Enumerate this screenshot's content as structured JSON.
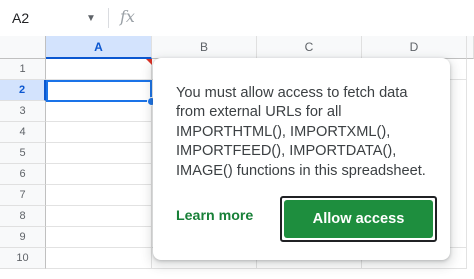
{
  "formula_bar": {
    "namebox_value": "A2",
    "caret": "▼",
    "fx_label": "fx"
  },
  "grid": {
    "columns": [
      "A",
      "B",
      "C",
      "D"
    ],
    "rows": [
      "1",
      "2",
      "3",
      "4",
      "5",
      "6",
      "7",
      "8",
      "9",
      "10"
    ],
    "selected_column": "A",
    "selected_row": "2",
    "active_cell": "A2"
  },
  "dialog": {
    "message": "You must allow access to fetch data from external URLs for all IMPORTHTML(), IMPORTXML(), IMPORTFEED(), IMPORTDATA(), IMAGE() functions in this spreadsheet.",
    "learn_more_label": "Learn more",
    "allow_label": "Allow access"
  },
  "colors": {
    "accent_blue": "#1a73e8",
    "allow_button_green": "#1e8e3e",
    "learn_more_green": "#188038"
  }
}
